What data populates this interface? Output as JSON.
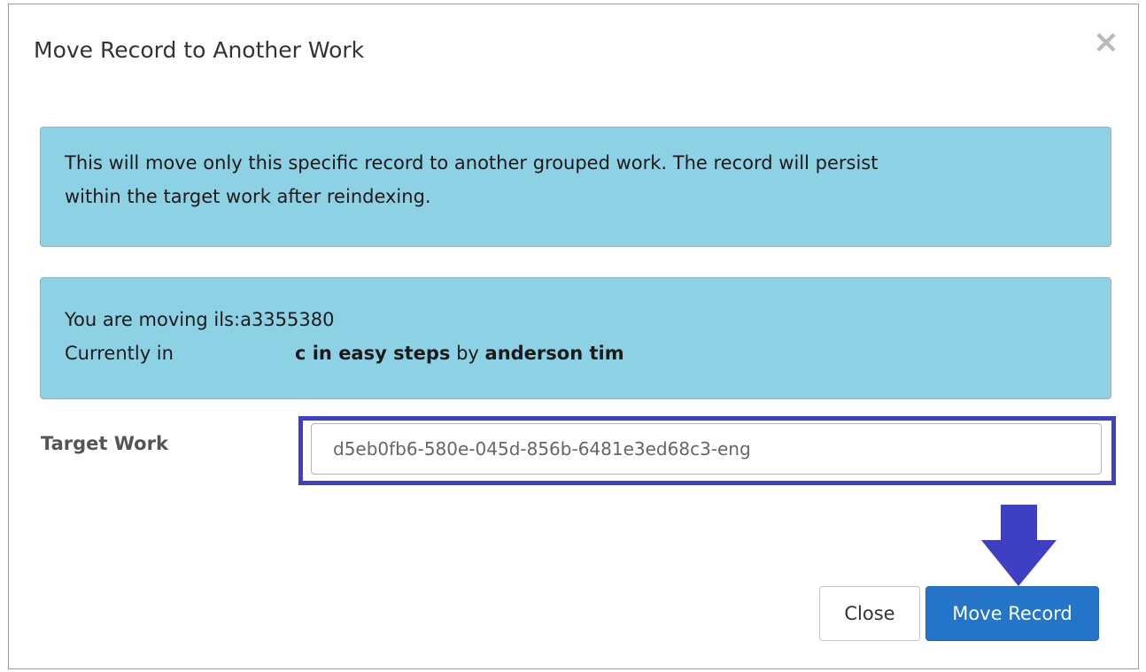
{
  "dialog": {
    "title": "Move Record to Another Work",
    "close_icon": "close-icon"
  },
  "info_alert": {
    "line1": "This will move only this specific record to another grouped work. The record will persist",
    "line2": "within the target work after reindexing."
  },
  "moving_alert": {
    "moving_prefix": "You are moving ",
    "record_id": "ils:a3355380",
    "currently_in_label": "Currently in",
    "work_title": "c in easy steps",
    "by_word": " by ",
    "author": "anderson tim"
  },
  "form": {
    "target_work_label": "Target Work",
    "target_work_value": "d5eb0fb6-580e-045d-856b-6481e3ed68c3-eng"
  },
  "buttons": {
    "close_label": "Close",
    "move_label": "Move Record"
  },
  "annotations": {
    "highlight_color": "#3f3fc4",
    "arrow_icon": "arrow-down-icon"
  },
  "colors": {
    "alert_background": "#8dd1e5",
    "primary_button": "#2474c8"
  }
}
